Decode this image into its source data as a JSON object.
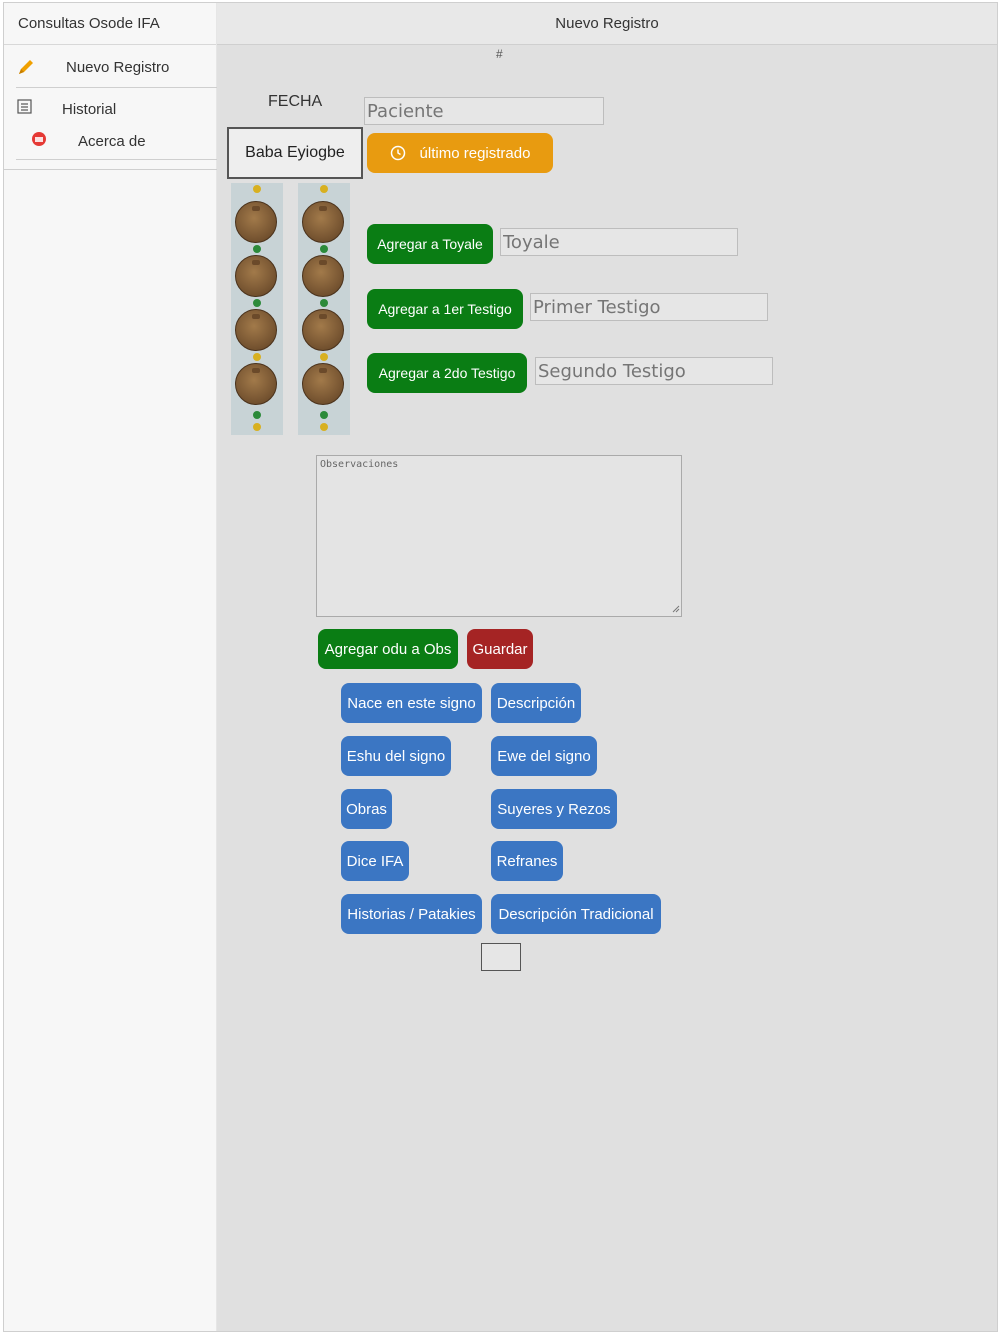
{
  "sidebar": {
    "title": "Consultas Osode IFA",
    "items": [
      {
        "label": "Nuevo Registro",
        "icon": "pencil-icon"
      },
      {
        "label": "Historial",
        "icon": "list-icon"
      },
      {
        "label": "Acerca de",
        "icon": "info-badge-icon"
      }
    ]
  },
  "header": {
    "title": "Nuevo Registro",
    "record_number": "#"
  },
  "form": {
    "fecha_label": "FECHA",
    "paciente_placeholder": "Paciente",
    "sign_name": "Baba Eyiogbe",
    "last_registered_label": "último registrado",
    "toyale_button": "Agregar a Toyale",
    "toyale_placeholder": "Toyale",
    "testigo1_button": "Agregar a 1er Testigo",
    "testigo1_placeholder": "Primer Testigo",
    "testigo2_button": "Agregar a 2do Testigo",
    "testigo2_placeholder": "Segundo Testigo",
    "observaciones_placeholder": "Observaciones",
    "add_odu_button": "Agregar odu a Obs",
    "save_button": "Guardar"
  },
  "info_buttons": [
    "Nace en este signo",
    "Descripción",
    "Eshu del signo",
    "Ewe del signo",
    "Obras",
    "Suyeres y Rezos",
    "Dice IFA",
    "Refranes",
    "Historias / Patakies",
    "Descripción Tradicional"
  ],
  "colors": {
    "green": "#0a7d14",
    "orange": "#e89b10",
    "red": "#a52424",
    "blue": "#3b76c3"
  }
}
